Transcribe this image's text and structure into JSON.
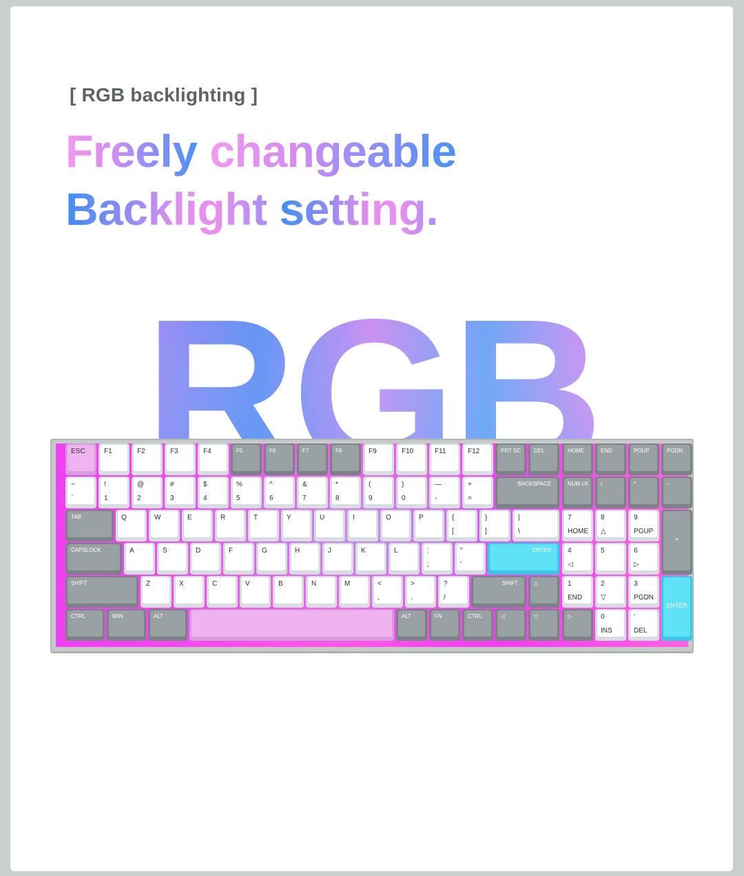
{
  "eyebrow": "[ RGB backlighting ]",
  "headline": {
    "line1": [
      "Freely",
      "changeable"
    ],
    "line2": [
      "Backlight",
      "setting."
    ]
  },
  "big_word": "RGB",
  "keyboard": {
    "rows": [
      [
        [
          "ESC",
          ""
        ],
        [
          "F1",
          ""
        ],
        [
          "F2",
          ""
        ],
        [
          "F3",
          ""
        ],
        [
          "F4",
          ""
        ],
        [
          "F5",
          ""
        ],
        [
          "F6",
          ""
        ],
        [
          "F7",
          ""
        ],
        [
          "F8",
          ""
        ],
        [
          "F9",
          ""
        ],
        [
          "F10",
          ""
        ],
        [
          "F11",
          ""
        ],
        [
          "F12",
          ""
        ],
        [
          "PRT SC",
          ""
        ],
        [
          "DEL",
          ""
        ],
        [
          "HOME",
          ""
        ],
        [
          "END",
          ""
        ],
        [
          "POUP",
          ""
        ],
        [
          "PGDN",
          ""
        ]
      ],
      [
        [
          "~",
          "`"
        ],
        [
          "!",
          "1"
        ],
        [
          "@",
          "2"
        ],
        [
          "#",
          "3"
        ],
        [
          "$",
          "4"
        ],
        [
          "%",
          "5"
        ],
        [
          "^",
          "6"
        ],
        [
          "&",
          "7"
        ],
        [
          "*",
          "8"
        ],
        [
          "(",
          "9"
        ],
        [
          ")",
          "0"
        ],
        [
          "—",
          "-"
        ],
        [
          "+",
          "="
        ],
        [
          "BACKSPACE",
          ""
        ],
        [
          "NUM LK",
          ""
        ],
        [
          "/",
          ""
        ],
        [
          "*",
          ""
        ],
        [
          "−",
          ""
        ]
      ],
      [
        [
          "TAB",
          ""
        ],
        [
          "Q",
          ""
        ],
        [
          "W",
          ""
        ],
        [
          "E",
          ""
        ],
        [
          "R",
          ""
        ],
        [
          "T",
          ""
        ],
        [
          "Y",
          ""
        ],
        [
          "U",
          ""
        ],
        [
          "I",
          ""
        ],
        [
          "O",
          ""
        ],
        [
          "P",
          ""
        ],
        [
          "{",
          "["
        ],
        [
          "}",
          "]"
        ],
        [
          "|",
          "\\"
        ],
        [
          "7",
          "HOME"
        ],
        [
          "8",
          "△"
        ],
        [
          "9",
          "PGUP"
        ],
        [
          "+",
          ""
        ]
      ],
      [
        [
          "CAPSLOCK",
          ""
        ],
        [
          "A",
          ""
        ],
        [
          "S",
          ""
        ],
        [
          "D",
          ""
        ],
        [
          "F",
          ""
        ],
        [
          "G",
          ""
        ],
        [
          "H",
          ""
        ],
        [
          "J",
          ""
        ],
        [
          "K",
          ""
        ],
        [
          "L",
          ""
        ],
        [
          ":",
          ";"
        ],
        [
          "\"",
          "'"
        ],
        [
          "ENTER",
          ""
        ],
        [
          "4",
          "◁"
        ],
        [
          "5",
          ""
        ],
        [
          "6",
          "▷"
        ]
      ],
      [
        [
          "SHIFT",
          ""
        ],
        [
          "Z",
          ""
        ],
        [
          "X",
          ""
        ],
        [
          "C",
          ""
        ],
        [
          "V",
          ""
        ],
        [
          "B",
          ""
        ],
        [
          "N",
          ""
        ],
        [
          "M",
          ""
        ],
        [
          "<",
          ","
        ],
        [
          ">",
          "."
        ],
        [
          "?",
          "/"
        ],
        [
          "SHIFT",
          ""
        ],
        [
          "△",
          ""
        ],
        [
          "1",
          "END"
        ],
        [
          "2",
          "▽"
        ],
        [
          "3",
          "PGDN"
        ],
        [
          "ENTER",
          ""
        ]
      ],
      [
        [
          "CTRL",
          ""
        ],
        [
          "WIN",
          ""
        ],
        [
          "ALT",
          ""
        ],
        [
          "",
          ""
        ],
        [
          "ALT",
          ""
        ],
        [
          "FN",
          ""
        ],
        [
          "CTRL",
          ""
        ],
        [
          "◁",
          ""
        ],
        [
          "▽",
          ""
        ],
        [
          "▷",
          ""
        ],
        [
          "0",
          "INS"
        ],
        [
          "'",
          "DEL"
        ]
      ]
    ]
  }
}
